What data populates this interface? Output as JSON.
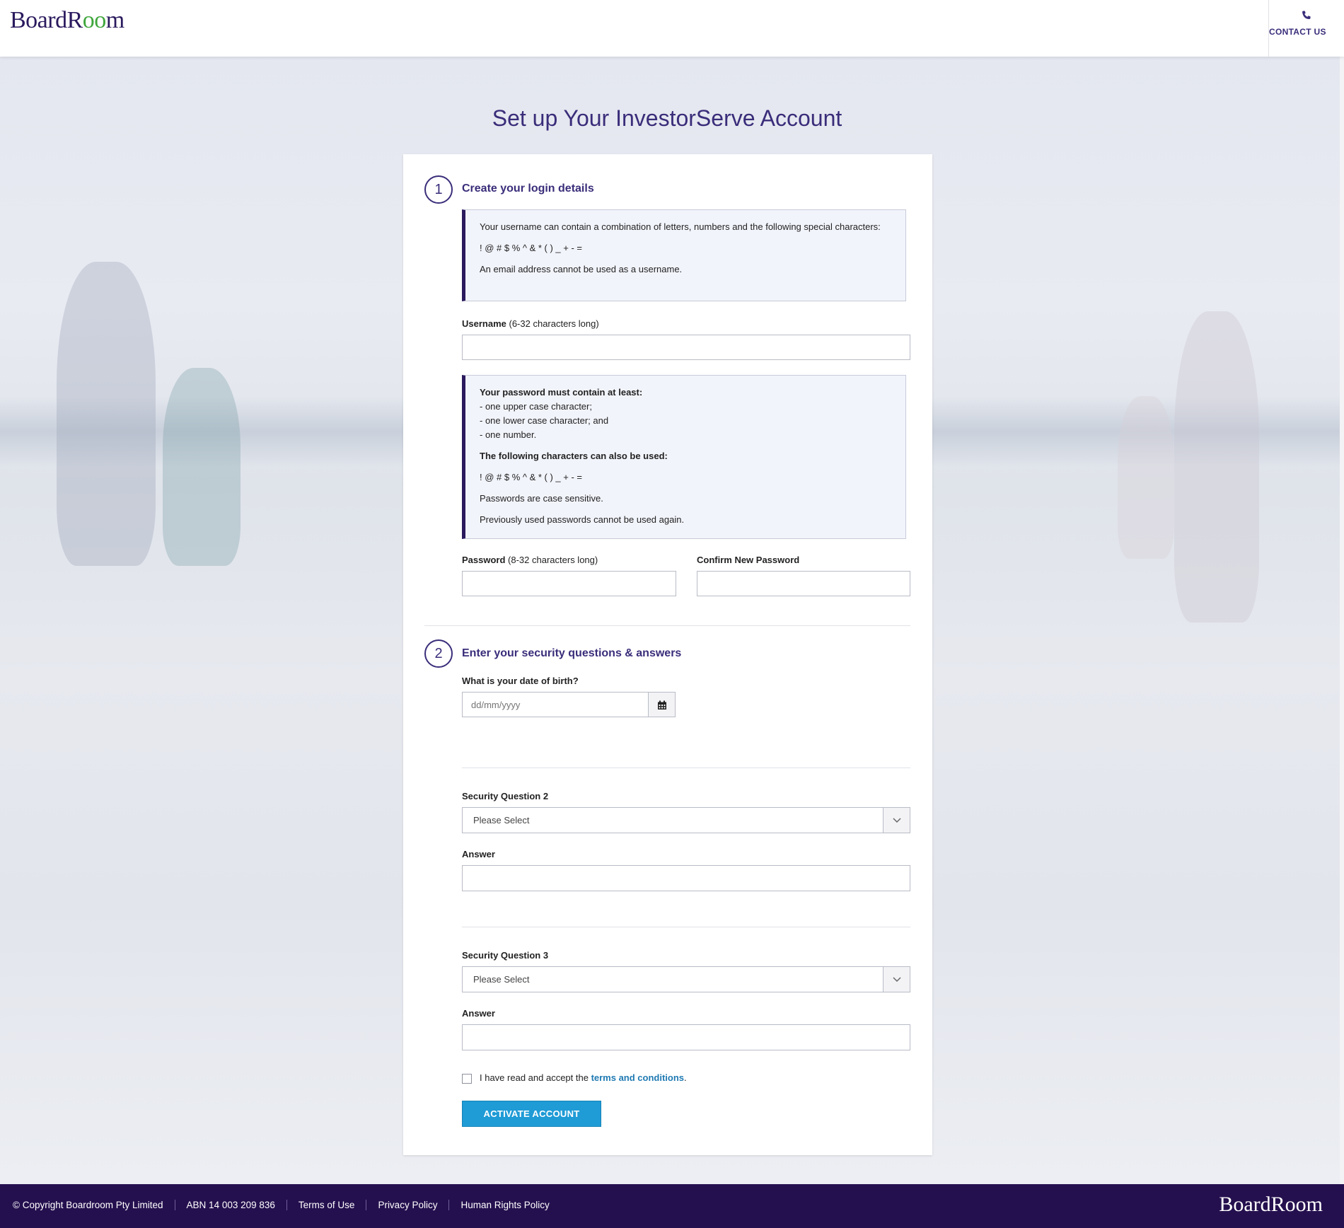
{
  "header": {
    "logo_text_a": "BoardR",
    "logo_text_b": "oo",
    "logo_text_c": "m",
    "contact_label": "CONTACT US"
  },
  "page_title": "Set up Your InvestorServe Account",
  "section1": {
    "number": "1",
    "title": "Create your login details",
    "username_info": {
      "line1": "Your username can contain a combination of letters, numbers and the following special characters:",
      "chars": "! @ # $ % ^ & * ( ) _ + - =",
      "line3": "An email address cannot be used as a username."
    },
    "username_label": "Username",
    "username_hint": "(6-32 characters long)",
    "username_value": "",
    "password_info": {
      "heading": "Your password must contain at least:",
      "req1": "- one upper case character;",
      "req2": "- one lower case character; and",
      "req3": "- one number.",
      "also_heading": "The following characters can also be used:",
      "chars": "! @ # $ % ^ & * ( ) _ + - =",
      "case_note": "Passwords are case sensitive.",
      "reuse_note": "Previously used passwords cannot be used again."
    },
    "password_label": "Password",
    "password_hint": "(8-32 characters long)",
    "password_value": "",
    "confirm_label": "Confirm New Password",
    "confirm_value": ""
  },
  "section2": {
    "number": "2",
    "title": "Enter your security questions & answers",
    "dob_label": "What is your date of birth?",
    "dob_placeholder": "dd/mm/yyyy",
    "q2_label": "Security Question 2",
    "q2_selected": "Please Select",
    "a2_label": "Answer",
    "a2_value": "",
    "q3_label": "Security Question 3",
    "q3_selected": "Please Select",
    "a3_label": "Answer",
    "a3_value": ""
  },
  "terms": {
    "prefix": "I have read and accept the ",
    "link": "terms and conditions",
    "suffix": ".",
    "checked": false
  },
  "activate_button": "ACTIVATE ACCOUNT",
  "footer": {
    "copyright": "© Copyright Boardroom Pty Limited",
    "abn": "ABN 14 003 209 836",
    "terms": "Terms of Use",
    "privacy": "Privacy Policy",
    "human_rights": "Human Rights Policy",
    "logo": "BoardRoom"
  },
  "colors": {
    "brand_purple": "#3a2d7a",
    "footer_bg": "#25104f",
    "button_blue": "#1f9bd6",
    "link_blue": "#1f7ab3",
    "logo_green": "#3fa63c"
  }
}
